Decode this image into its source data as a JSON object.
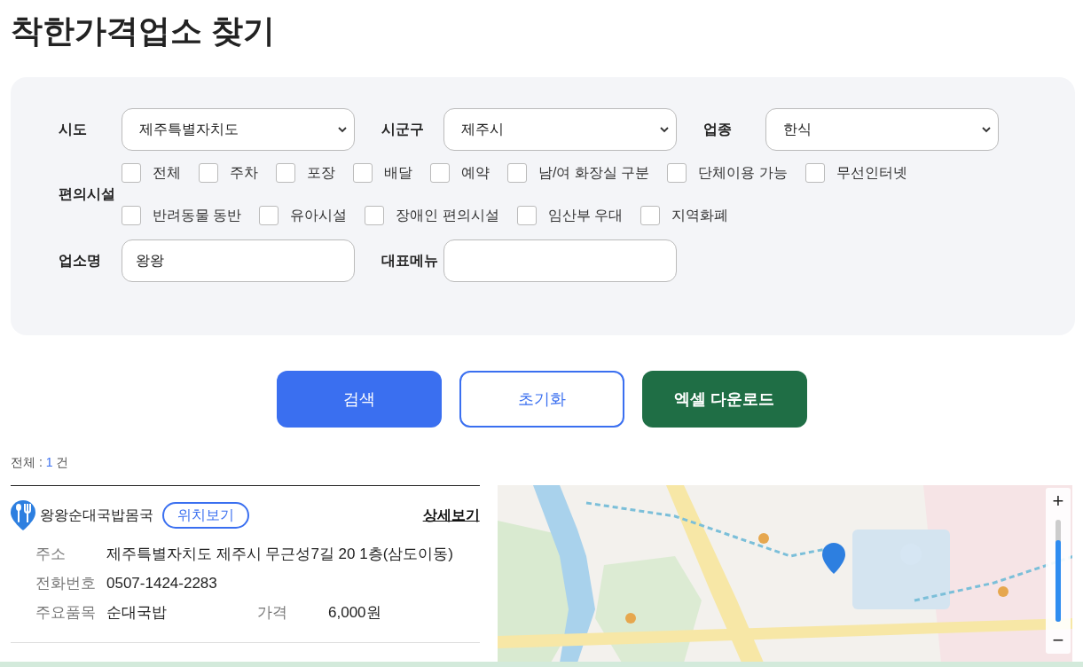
{
  "title": "착한가격업소 찾기",
  "selects": [
    {
      "label": "시도",
      "value": "제주특별자치도"
    },
    {
      "label": "시군구",
      "value": "제주시"
    },
    {
      "label": "업종",
      "value": "한식"
    }
  ],
  "facilities": {
    "label": "편의시설",
    "options": [
      {
        "label": "전체",
        "checked": false
      },
      {
        "label": "주차",
        "checked": false
      },
      {
        "label": "포장",
        "checked": false
      },
      {
        "label": "배달",
        "checked": false
      },
      {
        "label": "예약",
        "checked": false
      },
      {
        "label": "남/여 화장실 구분",
        "checked": false
      },
      {
        "label": "단체이용 가능",
        "checked": false
      },
      {
        "label": "무선인터넷",
        "checked": false
      },
      {
        "label": "반려동물 동반",
        "checked": false
      },
      {
        "label": "유아시설",
        "checked": false
      },
      {
        "label": "장애인 편의시설",
        "checked": false
      },
      {
        "label": "임산부 우대",
        "checked": false
      },
      {
        "label": "지역화폐",
        "checked": false
      }
    ]
  },
  "fields": [
    {
      "label": "업소명",
      "value": "왕왕"
    },
    {
      "label": "대표메뉴"
    }
  ],
  "buttons": [
    {
      "label": "검색",
      "kind": "primary"
    },
    {
      "label": "초기화",
      "kind": "outline"
    },
    {
      "label": "엑셀 다운로드",
      "kind": "excel"
    }
  ],
  "total": {
    "prefix": "전체 :",
    "count": "1",
    "suffix": "건"
  },
  "results": [
    {
      "name": "왕왕순대국밥몸국",
      "locate": "위치보기",
      "detail": "상세보기",
      "rows": [
        [
          {
            "label": "주소",
            "value": "제주특별자치도 제주시 무근성7길 20 1층(삼도이동)"
          }
        ],
        [
          {
            "label": "전화번호",
            "value": "0507-1424-2283"
          }
        ],
        [
          {
            "label": "주요품목",
            "value": "순대국밥"
          },
          {
            "label": "가격",
            "value": "6,000원"
          }
        ]
      ]
    }
  ],
  "map": {
    "zoom_in": "+",
    "zoom_out": "−",
    "zoom": {
      "level": 0.8
    }
  }
}
